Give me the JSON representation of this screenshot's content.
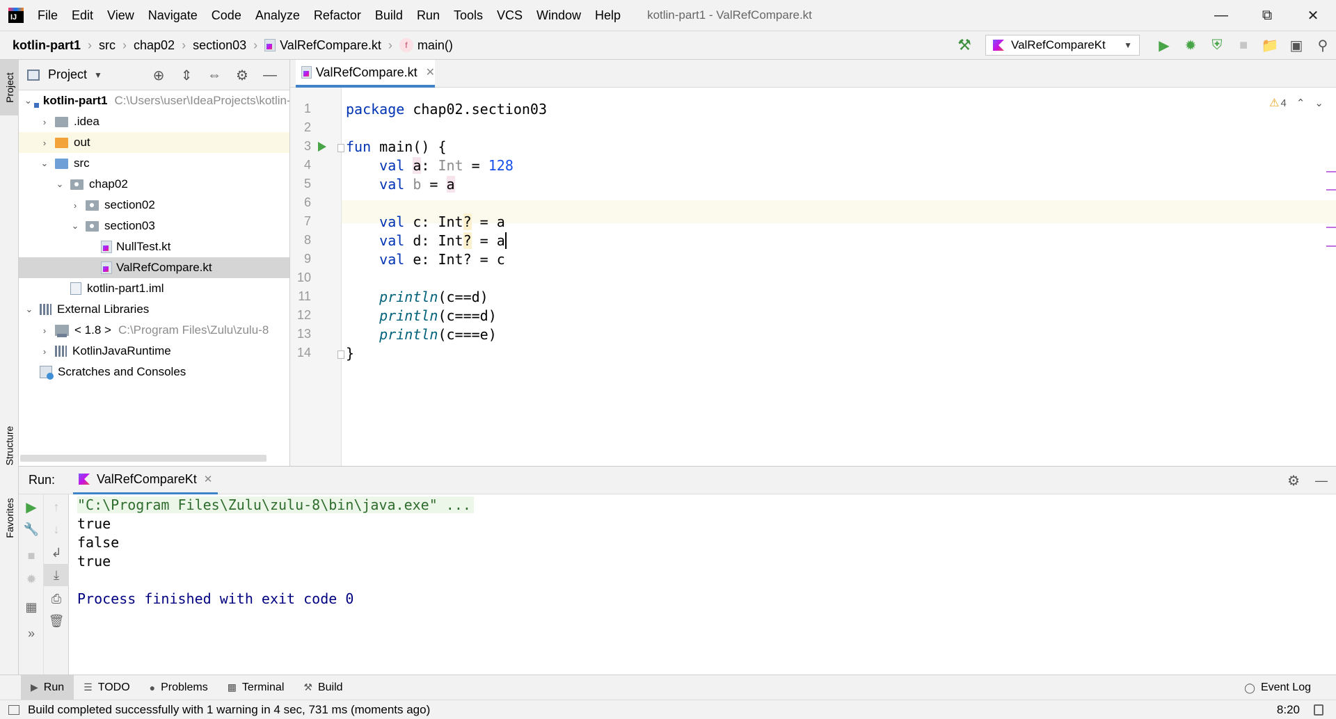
{
  "menubar": {
    "items": [
      "File",
      "Edit",
      "View",
      "Navigate",
      "Code",
      "Analyze",
      "Refactor",
      "Build",
      "Run",
      "Tools",
      "VCS",
      "Window",
      "Help"
    ],
    "window_title": "kotlin-part1 - ValRefCompare.kt"
  },
  "navbar": {
    "breadcrumb": [
      "kotlin-part1",
      "src",
      "chap02",
      "section03",
      "ValRefCompare.kt",
      "main()"
    ],
    "fun_badge": "f",
    "run_config": "ValRefCompareKt"
  },
  "left_strip": {
    "project_tab": "Project",
    "structure_tab": "Structure",
    "favorites_tab": "Favorites"
  },
  "project": {
    "title": "Project",
    "tree": [
      {
        "label": "kotlin-part1",
        "path": "C:\\Users\\user\\IdeaProjects\\kotlin-"
      },
      {
        "label": ".idea"
      },
      {
        "label": "out"
      },
      {
        "label": "src"
      },
      {
        "label": "chap02"
      },
      {
        "label": "section02"
      },
      {
        "label": "section03"
      },
      {
        "label": "NullTest.kt"
      },
      {
        "label": "ValRefCompare.kt"
      },
      {
        "label": "kotlin-part1.iml"
      },
      {
        "label": "External Libraries"
      },
      {
        "label": "< 1.8 >",
        "path": "C:\\Program Files\\Zulu\\zulu-8"
      },
      {
        "label": "KotlinJavaRuntime"
      },
      {
        "label": "Scratches and Consoles"
      }
    ]
  },
  "editor": {
    "tab": "ValRefCompare.kt",
    "warning_count": "4",
    "line_numbers": [
      "1",
      "2",
      "3",
      "4",
      "5",
      "6",
      "7",
      "8",
      "9",
      "10",
      "11",
      "12",
      "13",
      "14"
    ],
    "code": {
      "l1_kw": "package",
      "l1_rest": " chap02.section03",
      "l3_kw": "fun",
      "l3_rest": " main() {",
      "l4_kw": "val",
      "l4_var": "a",
      "l4_colon": ": ",
      "l4_type": "Int",
      "l4_eq": " = ",
      "l4_num": "128",
      "l5_kw": "val",
      "l5_var": "b",
      "l5_rest": " = ",
      "l5_ref": "a",
      "l7_kw": "val",
      "l7_a": " c: Int",
      "l7_q": "?",
      "l7_b": " = a",
      "l8_kw": "val",
      "l8_a": " d: Int",
      "l8_q": "?",
      "l8_b": " = ",
      "l8_cur": "a",
      "l9_kw": "val",
      "l9_rest": " e: Int? = c",
      "l11_fn": "println",
      "l11_rest": "(c==d)",
      "l12_fn": "println",
      "l12_rest": "(c===d)",
      "l13_fn": "println",
      "l13_rest": "(c===e)",
      "l14": "}"
    }
  },
  "run_panel": {
    "label": "Run:",
    "tab": "ValRefCompareKt",
    "console": [
      "\"C:\\Program Files\\Zulu\\zulu-8\\bin\\java.exe\" ...",
      "true",
      "false",
      "true",
      "",
      "Process finished with exit code 0"
    ]
  },
  "bottom_bar": {
    "items": [
      "Run",
      "TODO",
      "Problems",
      "Terminal",
      "Build"
    ],
    "event_log": "Event Log"
  },
  "status_bar": {
    "message": "Build completed successfully with 1 warning in 4 sec, 731 ms (moments ago)",
    "position": "8:20"
  },
  "colors": {
    "keyword": "#0033b3",
    "number": "#1750eb",
    "run_green": "#47a447",
    "tab_underline": "#4083c9",
    "exit_text": "#000080"
  }
}
